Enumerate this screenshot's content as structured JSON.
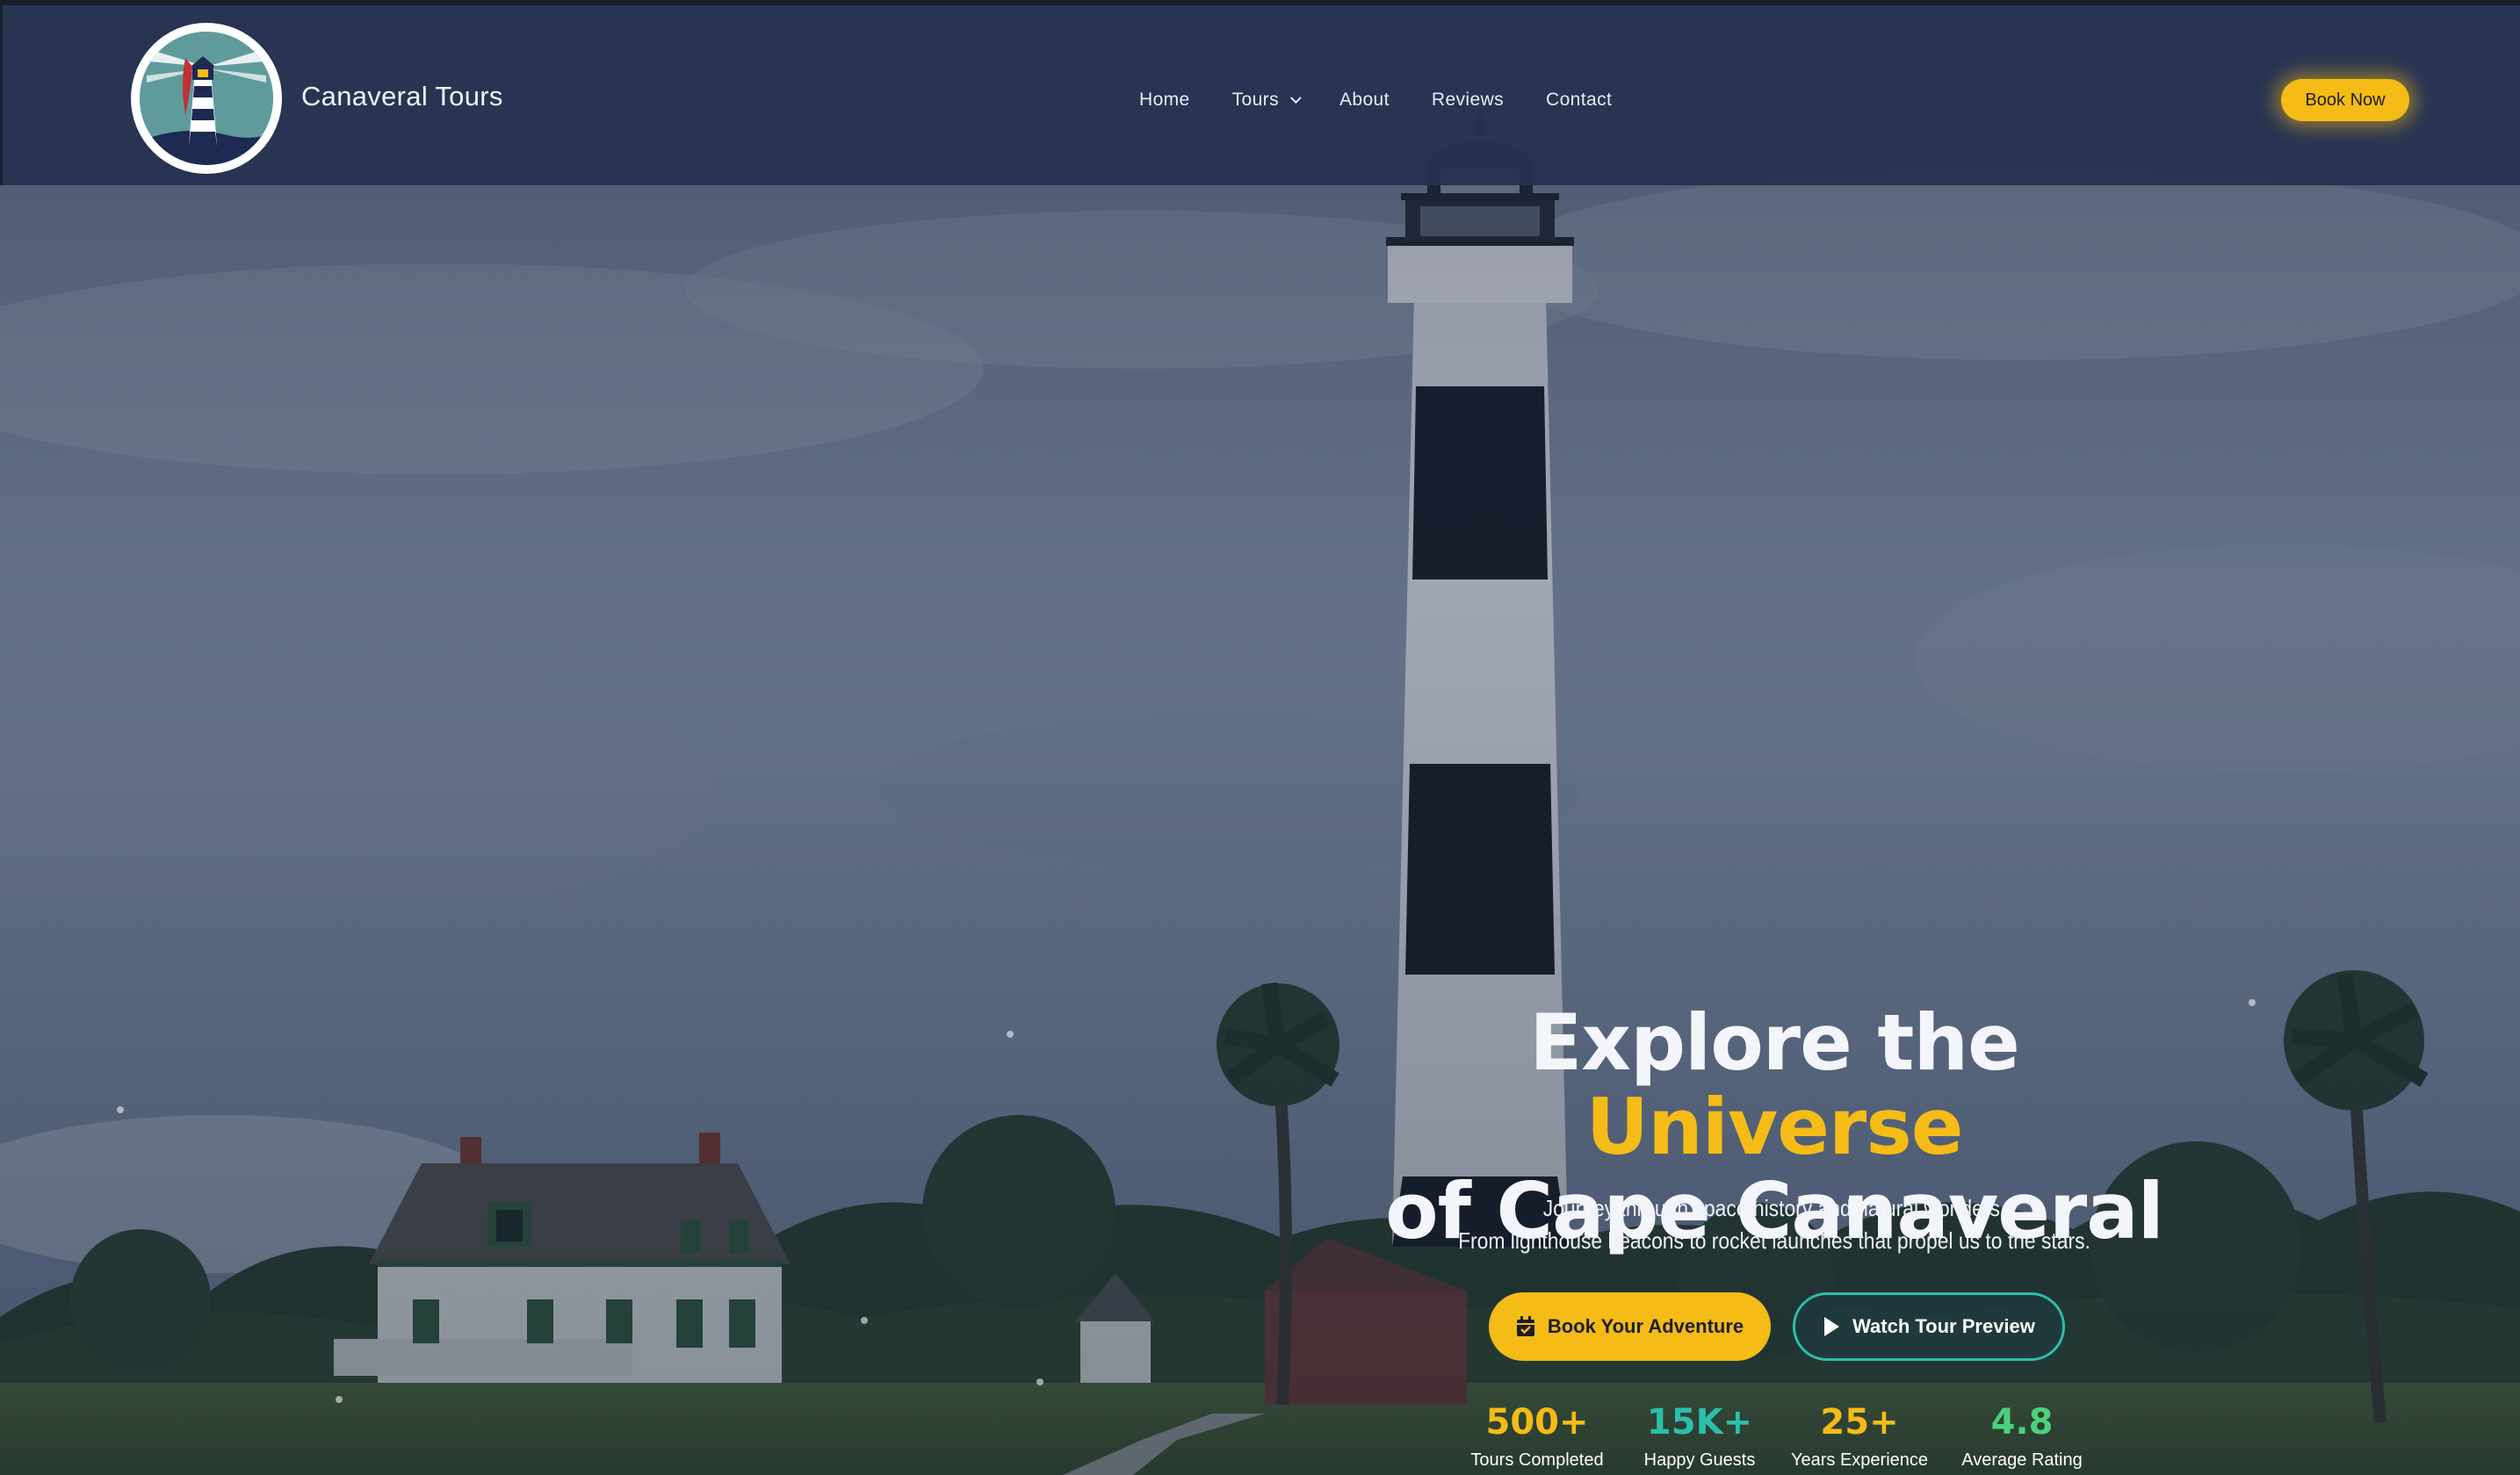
{
  "brand": {
    "name": "Canaveral Tours"
  },
  "nav": {
    "items": [
      {
        "label": "Home"
      },
      {
        "label": "Tours",
        "has_dropdown": true
      },
      {
        "label": "About"
      },
      {
        "label": "Reviews"
      },
      {
        "label": "Contact"
      }
    ],
    "cta_label": "Book Now"
  },
  "hero": {
    "title_part1": "Explore the ",
    "title_accent": "Universe",
    "title_part2": "of Cape Canaveral",
    "subtitle_line1": "Journey through space history and natural wonders.",
    "subtitle_line2": "From lighthouse beacons to rocket launches that propel us to the stars.",
    "primary_button": {
      "label": "Book Your Adventure",
      "icon": "calendar-icon"
    },
    "secondary_button": {
      "label": "Watch Tour Preview",
      "icon": "play-icon"
    }
  },
  "stats": [
    {
      "value": "500+",
      "label": "Tours Completed",
      "color": "#f5bb16"
    },
    {
      "value": "15K+",
      "label": "Happy Guests",
      "color": "#2bbfae"
    },
    {
      "value": "25+",
      "label": "Years Experience",
      "color": "#f5bb16"
    },
    {
      "value": "4.8",
      "label": "Average Rating",
      "color": "#4cd07d"
    }
  ],
  "colors": {
    "accent": "#f5bb16",
    "teal": "#2bbfae",
    "green": "#4cd07d",
    "header_bg": "#263250"
  }
}
